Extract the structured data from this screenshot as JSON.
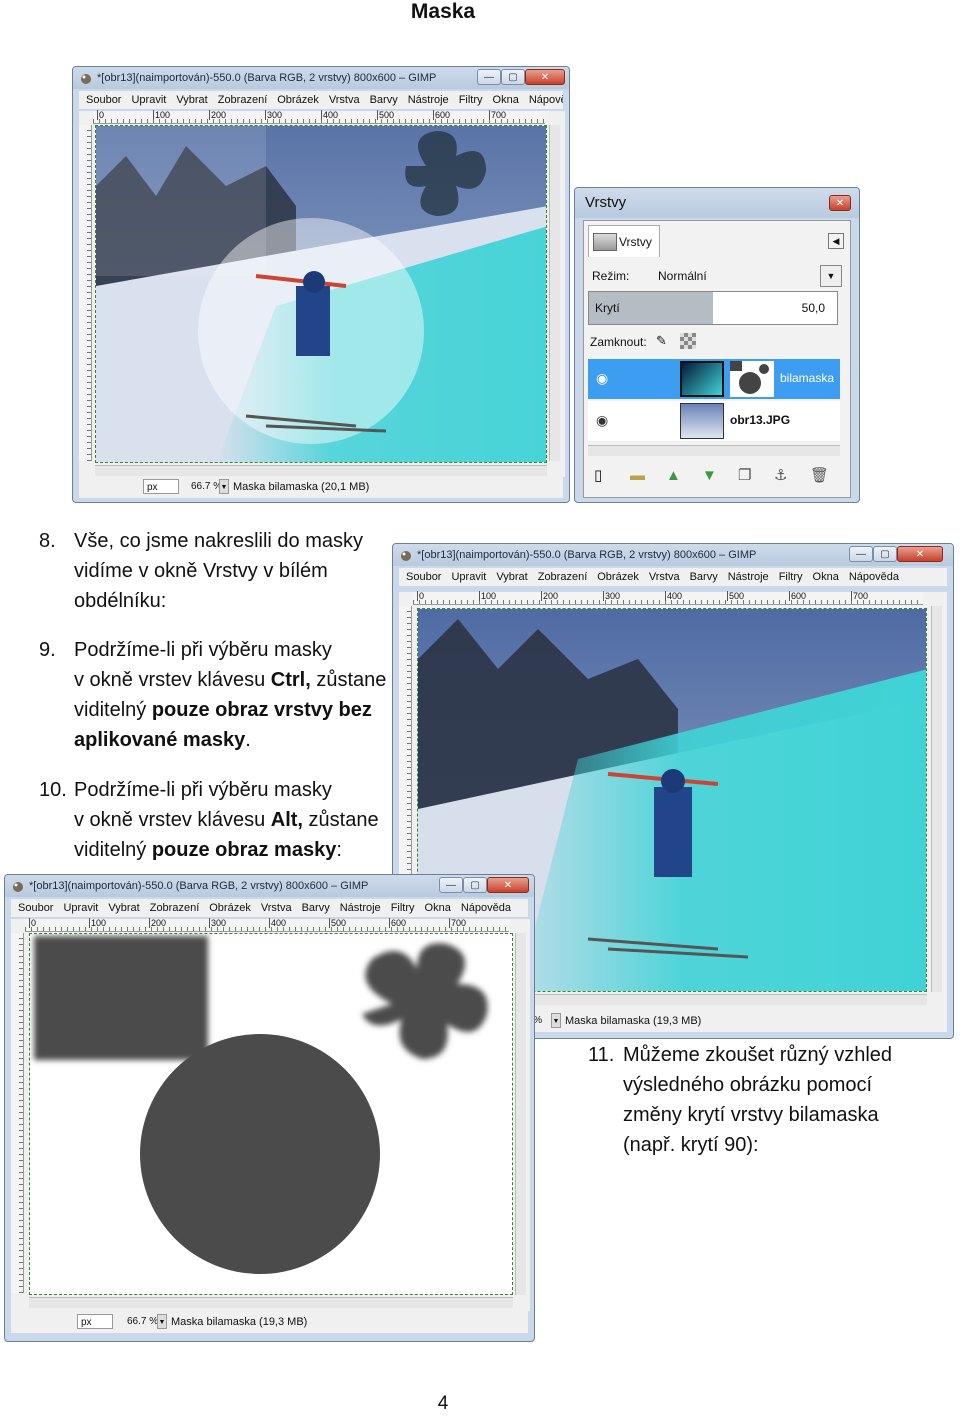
{
  "document": {
    "title": "Maska",
    "page_number": "4",
    "steps": [
      {
        "number": "8.",
        "lines": [
          "Vše, co jsme nakreslili do masky",
          "vidíme v okně Vrstvy v bílém",
          "obdélníku:"
        ]
      },
      {
        "number": "9.",
        "lines": [
          "Podržíme-li při výběru masky",
          "v okně vrstev klávesu",
          "Ctrl,",
          "zůstane",
          "viditelný",
          "pouze obraz vrstvy bez",
          "aplikované masky",
          "."
        ]
      },
      {
        "number": "10.",
        "lines": [
          "Podržíme-li při výběru masky",
          "v okně vrstev klávesu",
          "Alt,",
          "zůstane",
          "viditelný",
          "pouze obraz masky",
          ":"
        ]
      },
      {
        "number": "11.",
        "lines": [
          "Můžeme zkoušet různý vzhled",
          "výsledného obrázku pomocí",
          "změny krytí vrstvy bilamaska",
          "(např. krytí 90):"
        ]
      }
    ]
  },
  "gimp_windows": [
    {
      "title": "*[obr13](naimportován)-550.0 (Barva RGB, 2 vrstvy) 800x600 – GIMP",
      "status_unit": "px",
      "zoom": "66.7 %",
      "status_message": "Maska bilamaska (20,1 MB)"
    },
    {
      "title": "*[obr13](naimportován)-550.0 (Barva RGB, 2 vrstvy) 800x600 – GIMP",
      "status_unit": "px",
      "zoom": "66.7 %",
      "status_message": "Maska bilamaska (19,3 MB)"
    },
    {
      "title": "*[obr13](naimportován)-550.0 (Barva RGB, 2 vrstvy) 800x600 – GIMP",
      "status_unit": "px",
      "zoom": "66.7 %",
      "status_message": "Maska bilamaska (19,3 MB)"
    }
  ],
  "menu": [
    "Soubor",
    "Upravit",
    "Vybrat",
    "Zobrazení",
    "Obrázek",
    "Vrstva",
    "Barvy",
    "Nástroje",
    "Filtry",
    "Okna",
    "Nápověda"
  ],
  "ruler_ticks": [
    "0",
    "100",
    "200",
    "300",
    "400",
    "500",
    "600",
    "700"
  ],
  "window_buttons": {
    "minimize": "—",
    "maximize": "▢",
    "close": "✕"
  },
  "layers_panel": {
    "window_title": "Vrstvy",
    "tab_label": "Vrstvy",
    "mode_label": "Režim:",
    "mode_value": "Normální",
    "opacity_label": "Krytí",
    "opacity_value": "50,0",
    "lock_label": "Zamknout:",
    "layers": [
      {
        "name": "bilamaska",
        "selected": true
      },
      {
        "name": "obr13.JPG",
        "selected": false
      }
    ]
  },
  "colors": {
    "cyan_mask": "#3fd3d6",
    "selection_blue": "#3d9df0",
    "mask_gray": "#4b4b4b"
  }
}
